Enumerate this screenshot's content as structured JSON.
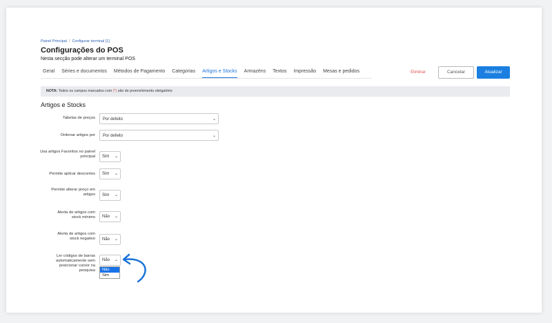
{
  "breadcrumb": {
    "home": "Painel Principal",
    "sep": "/",
    "current": "Configurar terminal [1]"
  },
  "header": {
    "title": "Configurações do POS",
    "subtitle": "Nesta secção pode alterar um terminal POS"
  },
  "tabs": [
    {
      "label": "Geral"
    },
    {
      "label": "Séries e documentos"
    },
    {
      "label": "Métodos de Pagamento"
    },
    {
      "label": "Categorias"
    },
    {
      "label": "Artigos e Stocks"
    },
    {
      "label": "Armazéns"
    },
    {
      "label": "Textos"
    },
    {
      "label": "Impressão"
    },
    {
      "label": "Mesas e pedidos"
    }
  ],
  "active_tab": "Artigos e Stocks",
  "actions": {
    "delete": "Eliminar",
    "cancel": "Cancelar",
    "update": "Atualizar"
  },
  "note": {
    "prefix": "NOTA:",
    "text_before": " Todos os campos marcados com ",
    "required_mark": "(*)",
    "text_after": " são de preenchimento obrigatório"
  },
  "section": {
    "title": "Artigos e Stocks"
  },
  "fields": {
    "price_table": {
      "label": "Tabelas de preços",
      "value": "Por defeito"
    },
    "order_by": {
      "label": "Ordenar artigos por",
      "value": "Por defeito"
    },
    "favorites": {
      "label": "Usa artigos Favoritos no painel principal",
      "value": "Sim"
    },
    "discounts": {
      "label": "Permite aplicar descontos",
      "value": "Sim"
    },
    "change_price": {
      "label": "Permite alterar preço em artigos",
      "value": "Sim"
    },
    "min_stock_alert": {
      "label": "Alerta de artigos com stock mínimo",
      "value": "Não"
    },
    "negative_stock_alert": {
      "label": "Alerta de artigos com stock negativo",
      "value": "Não"
    },
    "barcode_read": {
      "label": "Ler códigos de barras automaticamente sem posicionar cursor na pesquisa",
      "value": "Não",
      "options": [
        "Não",
        "Sim"
      ]
    }
  },
  "colors": {
    "accent": "#1a7fe0",
    "delete": "#d9534f",
    "callout_arrow": "#1a73d9"
  },
  "icons": {
    "select_chevron": "chevron-down-icon",
    "callout": "curved-arrow-icon"
  }
}
